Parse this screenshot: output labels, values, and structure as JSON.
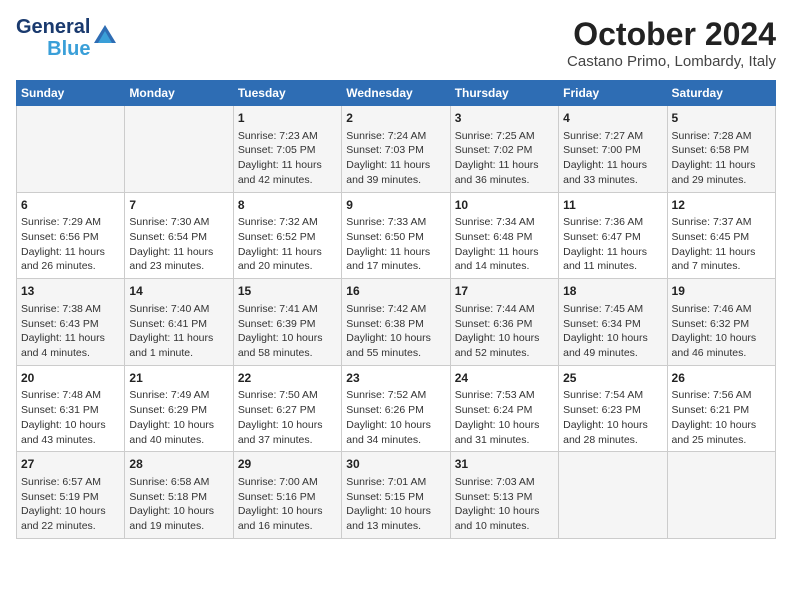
{
  "header": {
    "logo_line1": "General",
    "logo_line2": "Blue",
    "month_title": "October 2024",
    "location": "Castano Primo, Lombardy, Italy"
  },
  "weekdays": [
    "Sunday",
    "Monday",
    "Tuesday",
    "Wednesday",
    "Thursday",
    "Friday",
    "Saturday"
  ],
  "weeks": [
    [
      {
        "day": "",
        "info": ""
      },
      {
        "day": "",
        "info": ""
      },
      {
        "day": "1",
        "info": "Sunrise: 7:23 AM\nSunset: 7:05 PM\nDaylight: 11 hours and 42 minutes."
      },
      {
        "day": "2",
        "info": "Sunrise: 7:24 AM\nSunset: 7:03 PM\nDaylight: 11 hours and 39 minutes."
      },
      {
        "day": "3",
        "info": "Sunrise: 7:25 AM\nSunset: 7:02 PM\nDaylight: 11 hours and 36 minutes."
      },
      {
        "day": "4",
        "info": "Sunrise: 7:27 AM\nSunset: 7:00 PM\nDaylight: 11 hours and 33 minutes."
      },
      {
        "day": "5",
        "info": "Sunrise: 7:28 AM\nSunset: 6:58 PM\nDaylight: 11 hours and 29 minutes."
      }
    ],
    [
      {
        "day": "6",
        "info": "Sunrise: 7:29 AM\nSunset: 6:56 PM\nDaylight: 11 hours and 26 minutes."
      },
      {
        "day": "7",
        "info": "Sunrise: 7:30 AM\nSunset: 6:54 PM\nDaylight: 11 hours and 23 minutes."
      },
      {
        "day": "8",
        "info": "Sunrise: 7:32 AM\nSunset: 6:52 PM\nDaylight: 11 hours and 20 minutes."
      },
      {
        "day": "9",
        "info": "Sunrise: 7:33 AM\nSunset: 6:50 PM\nDaylight: 11 hours and 17 minutes."
      },
      {
        "day": "10",
        "info": "Sunrise: 7:34 AM\nSunset: 6:48 PM\nDaylight: 11 hours and 14 minutes."
      },
      {
        "day": "11",
        "info": "Sunrise: 7:36 AM\nSunset: 6:47 PM\nDaylight: 11 hours and 11 minutes."
      },
      {
        "day": "12",
        "info": "Sunrise: 7:37 AM\nSunset: 6:45 PM\nDaylight: 11 hours and 7 minutes."
      }
    ],
    [
      {
        "day": "13",
        "info": "Sunrise: 7:38 AM\nSunset: 6:43 PM\nDaylight: 11 hours and 4 minutes."
      },
      {
        "day": "14",
        "info": "Sunrise: 7:40 AM\nSunset: 6:41 PM\nDaylight: 11 hours and 1 minute."
      },
      {
        "day": "15",
        "info": "Sunrise: 7:41 AM\nSunset: 6:39 PM\nDaylight: 10 hours and 58 minutes."
      },
      {
        "day": "16",
        "info": "Sunrise: 7:42 AM\nSunset: 6:38 PM\nDaylight: 10 hours and 55 minutes."
      },
      {
        "day": "17",
        "info": "Sunrise: 7:44 AM\nSunset: 6:36 PM\nDaylight: 10 hours and 52 minutes."
      },
      {
        "day": "18",
        "info": "Sunrise: 7:45 AM\nSunset: 6:34 PM\nDaylight: 10 hours and 49 minutes."
      },
      {
        "day": "19",
        "info": "Sunrise: 7:46 AM\nSunset: 6:32 PM\nDaylight: 10 hours and 46 minutes."
      }
    ],
    [
      {
        "day": "20",
        "info": "Sunrise: 7:48 AM\nSunset: 6:31 PM\nDaylight: 10 hours and 43 minutes."
      },
      {
        "day": "21",
        "info": "Sunrise: 7:49 AM\nSunset: 6:29 PM\nDaylight: 10 hours and 40 minutes."
      },
      {
        "day": "22",
        "info": "Sunrise: 7:50 AM\nSunset: 6:27 PM\nDaylight: 10 hours and 37 minutes."
      },
      {
        "day": "23",
        "info": "Sunrise: 7:52 AM\nSunset: 6:26 PM\nDaylight: 10 hours and 34 minutes."
      },
      {
        "day": "24",
        "info": "Sunrise: 7:53 AM\nSunset: 6:24 PM\nDaylight: 10 hours and 31 minutes."
      },
      {
        "day": "25",
        "info": "Sunrise: 7:54 AM\nSunset: 6:23 PM\nDaylight: 10 hours and 28 minutes."
      },
      {
        "day": "26",
        "info": "Sunrise: 7:56 AM\nSunset: 6:21 PM\nDaylight: 10 hours and 25 minutes."
      }
    ],
    [
      {
        "day": "27",
        "info": "Sunrise: 6:57 AM\nSunset: 5:19 PM\nDaylight: 10 hours and 22 minutes."
      },
      {
        "day": "28",
        "info": "Sunrise: 6:58 AM\nSunset: 5:18 PM\nDaylight: 10 hours and 19 minutes."
      },
      {
        "day": "29",
        "info": "Sunrise: 7:00 AM\nSunset: 5:16 PM\nDaylight: 10 hours and 16 minutes."
      },
      {
        "day": "30",
        "info": "Sunrise: 7:01 AM\nSunset: 5:15 PM\nDaylight: 10 hours and 13 minutes."
      },
      {
        "day": "31",
        "info": "Sunrise: 7:03 AM\nSunset: 5:13 PM\nDaylight: 10 hours and 10 minutes."
      },
      {
        "day": "",
        "info": ""
      },
      {
        "day": "",
        "info": ""
      }
    ]
  ]
}
